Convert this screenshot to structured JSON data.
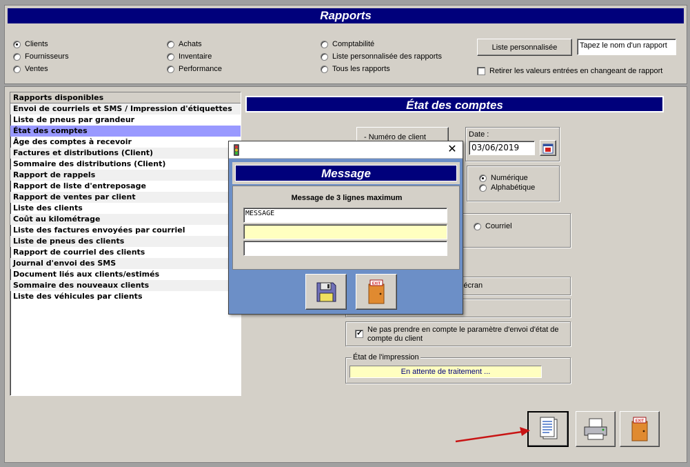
{
  "header": {
    "title": "Rapports"
  },
  "categories": {
    "col1": [
      {
        "label": "Clients",
        "selected": true
      },
      {
        "label": "Fournisseurs",
        "selected": false
      },
      {
        "label": "Ventes",
        "selected": false
      }
    ],
    "col2": [
      {
        "label": "Achats",
        "selected": false
      },
      {
        "label": "Inventaire",
        "selected": false
      },
      {
        "label": "Performance",
        "selected": false
      }
    ],
    "col3": [
      {
        "label": "Comptabilité",
        "selected": false
      },
      {
        "label": "Liste personnalisée des rapports",
        "selected": false
      },
      {
        "label": "Tous les rapports",
        "selected": false
      }
    ]
  },
  "custom_list_button": "Liste personnalisée",
  "report_name_input": {
    "value": "Tapez le nom d'un rapport"
  },
  "clear_values_checkbox": {
    "label": "Retirer les valeurs entrées en changeant de rapport",
    "checked": false
  },
  "report_list": {
    "header": "Rapports disponibles",
    "items": [
      "Envoi de courriels et SMS / Impression d'étiquettes",
      "Liste de pneus par grandeur",
      "État des comptes",
      "Âge des comptes à recevoir",
      "Factures et distributions (Client)",
      "Sommaire des distributions (Client)",
      "Rapport de rappels",
      "Rapport de liste d'entreposage",
      "Rapport de ventes par client",
      "Liste des clients",
      "Coût au kilométrage",
      "Liste des factures envoyées par courriel",
      "Liste de pneus des clients",
      "Rapport de courriel des clients",
      "Journal d'envoi des SMS",
      "Document liés aux clients/estimés",
      "Sommaire des nouveaux clients",
      "Liste des véhicules par clients"
    ],
    "selected_index": 2
  },
  "report_panel": {
    "title": "État des comptes",
    "client_number_label": "- Numéro de client",
    "date_label": "Date :",
    "date_value": "03/06/2019",
    "sort_options": [
      {
        "label": "Numérique",
        "selected": true
      },
      {
        "label": "Alphabétique",
        "selected": false
      }
    ],
    "output_option_courriel": "Courriel",
    "screen_option_partial": "l'écran",
    "ignore_send_checkbox": {
      "label": "Ne pas prendre en compte le paramètre d'envoi d'état de compte du client",
      "checked": true
    },
    "print_status_group": "État de l'impression",
    "print_status_value": "En attente de traitement ..."
  },
  "dialog": {
    "title_bar": "",
    "heading": "Message",
    "subheading": "Message de 3 lignes maximum",
    "lines": [
      "MESSAGE",
      "",
      ""
    ],
    "save_icon": "floppy-disk-icon",
    "exit_label": "EXIT"
  },
  "bottom_buttons": {
    "preview_icon": "report-preview-icon",
    "print_icon": "printer-icon",
    "exit_label": "EXIT"
  },
  "colors": {
    "navy": "#00007b",
    "selection": "#9999ff",
    "status_yellow": "#ffffc0",
    "dialog_blue": "#6c8fc7",
    "arrow_red": "#c81414"
  }
}
